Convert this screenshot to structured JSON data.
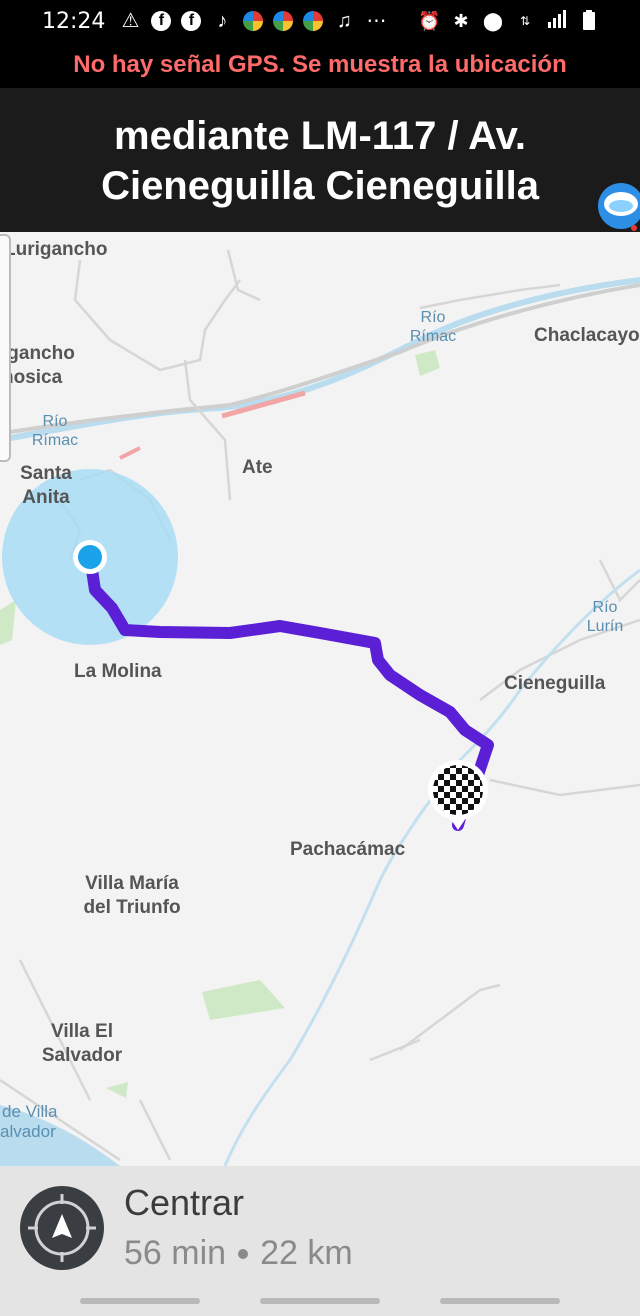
{
  "status_bar": {
    "time": "12:24",
    "left_icons": [
      "warning-icon",
      "facebook-icon",
      "facebook-icon",
      "tiktok-icon",
      "app-icon",
      "app-icon",
      "app-icon",
      "music-icon",
      "more-icon"
    ],
    "right_icons": [
      "alarm-icon",
      "bluetooth-icon",
      "location-icon",
      "data-icon",
      "signal-icon",
      "battery-icon"
    ]
  },
  "gps_warning": "No hay señal GPS. Se muestra la ubicación",
  "route_header": {
    "line1": "mediante LM-117 / Av.",
    "line2": "Cieneguilla Cieneguilla"
  },
  "map": {
    "places": {
      "lurigancho": "Lurigancho",
      "lurigancho_chosica_1": "igancho",
      "lurigancho_chosica_2": "hosica",
      "santa_anita_1": "Santa",
      "santa_anita_2": "Anita",
      "ate": "Ate",
      "chaclacayo": "Chaclacayo",
      "la_molina": "La Molina",
      "cieneguilla": "Cieneguilla",
      "pachacamac": "Pachacámac",
      "villa_maria_1": "Villa María",
      "villa_maria_2": "del Triunfo",
      "villa_el_salvador_1": "Villa El",
      "villa_el_salvador_2": "Salvador",
      "playa_1": "de Villa",
      "playa_2": "alvador"
    },
    "rivers": {
      "rimac_left_1": "Río",
      "rimac_left_2": "Rímac",
      "rimac_right_1": "Río",
      "rimac_right_2": "Rímac",
      "lurin_1": "Río",
      "lurin_2": "Lurín"
    },
    "colors": {
      "route": "#5b1fd6",
      "position": "#1aa3e8",
      "accuracy_circle": "#a8dcf4",
      "water": "#b9dcee",
      "parks": "#cfe9c6"
    }
  },
  "bottom_panel": {
    "recenter_label": "Centrar",
    "duration": "56 min",
    "distance": "22 km"
  }
}
